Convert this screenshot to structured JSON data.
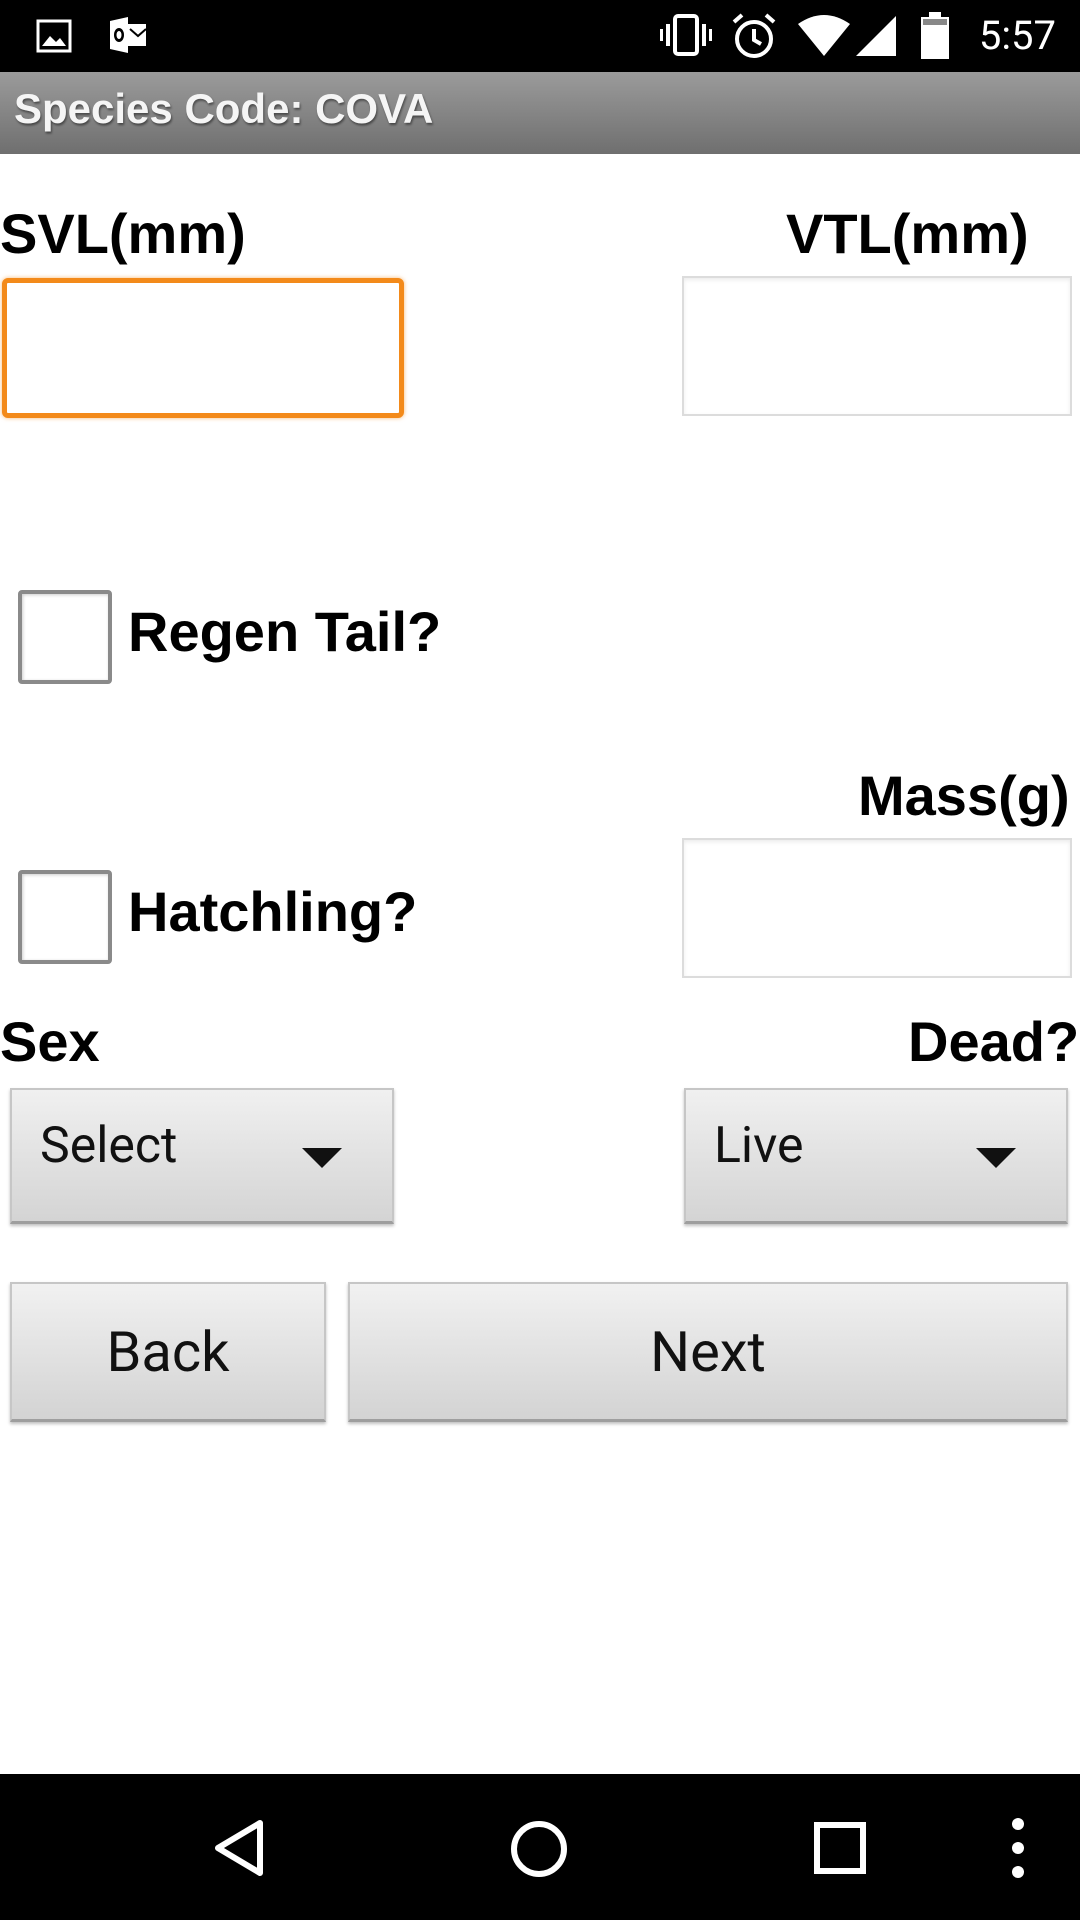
{
  "status_bar": {
    "time": "5:57",
    "left_icons": [
      "image-icon",
      "outlook-icon"
    ],
    "right_icons": [
      "vibrate-icon",
      "alarm-icon",
      "wifi-icon",
      "signal-icon",
      "battery-icon"
    ]
  },
  "title_bar": {
    "title": "Species Code: COVA"
  },
  "form": {
    "svl_label": "SVL(mm)",
    "vtl_label": "VTL(mm)",
    "svl_value": "",
    "vtl_value": "",
    "regen_tail_label": "Regen Tail?",
    "regen_tail_checked": false,
    "mass_label": "Mass(g)",
    "mass_value": "",
    "hatchling_label": "Hatchling?",
    "hatchling_checked": false,
    "sex_label": "Sex",
    "sex_selected": "Select",
    "dead_label": "Dead?",
    "dead_selected": "Live"
  },
  "buttons": {
    "back": "Back",
    "next": "Next"
  },
  "nav_bar": {
    "icons": [
      "back-triangle-icon",
      "home-circle-icon",
      "recents-square-icon",
      "overflow-menu-icon"
    ]
  },
  "colors": {
    "focus_accent": "#f38a1a",
    "title_bar": "#888888",
    "status_bar": "#000000"
  }
}
